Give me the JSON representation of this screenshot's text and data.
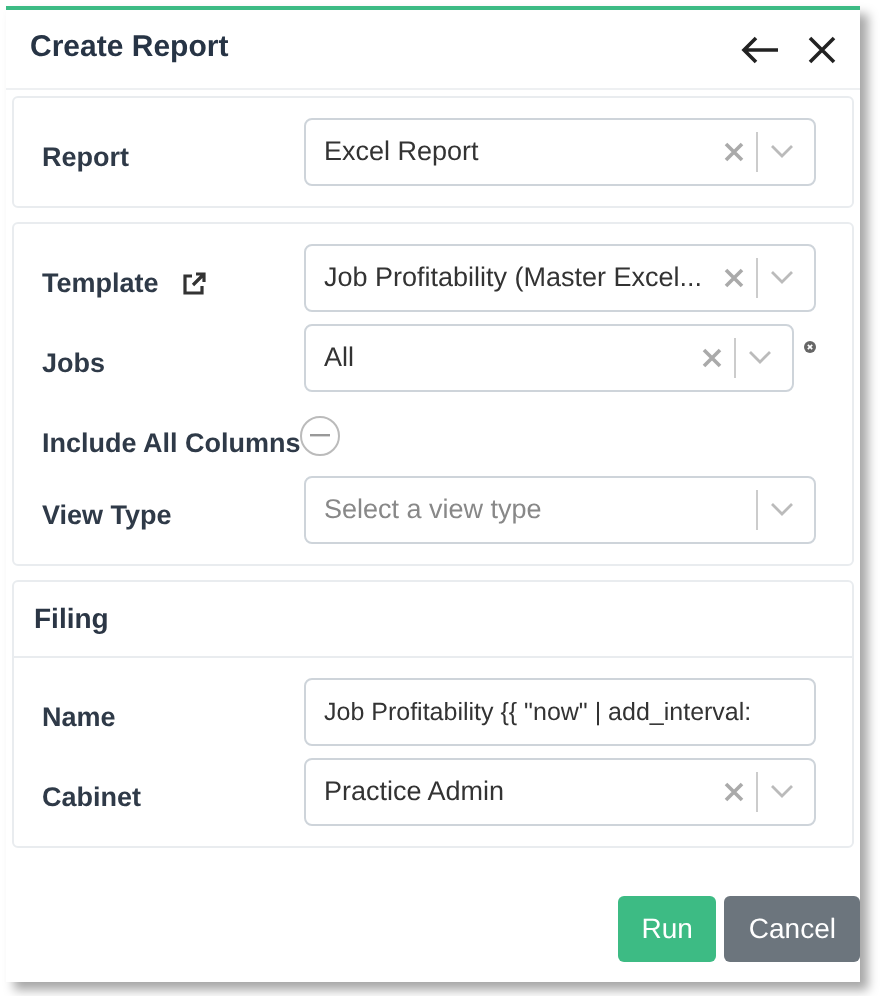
{
  "title": "Create Report",
  "sections": [
    {
      "fields": [
        {
          "kind": "select",
          "label": "Report",
          "value": "Excel Report",
          "clearable": true
        }
      ]
    },
    {
      "fields": [
        {
          "kind": "select",
          "label": "Template",
          "link": true,
          "value": "Job Profitability (Master Excel...",
          "clearable": true
        },
        {
          "kind": "select",
          "label": "Jobs",
          "value": "All",
          "clearable": true,
          "removable": true
        },
        {
          "kind": "toggle",
          "label": "Include All Columns",
          "on": false
        },
        {
          "kind": "select",
          "label": "View Type",
          "placeholder": "Select a view type",
          "clearable": false
        }
      ]
    },
    {
      "heading": "Filing",
      "fields": [
        {
          "kind": "text",
          "label": "Name",
          "value": "Job Profitability {{ \"now\" | add_interval:"
        },
        {
          "kind": "select",
          "label": "Cabinet",
          "value": "Practice Admin",
          "clearable": true
        }
      ]
    }
  ],
  "buttons": [
    {
      "label": "Run",
      "kind": "primary"
    },
    {
      "label": "Cancel",
      "kind": "secondary"
    }
  ]
}
